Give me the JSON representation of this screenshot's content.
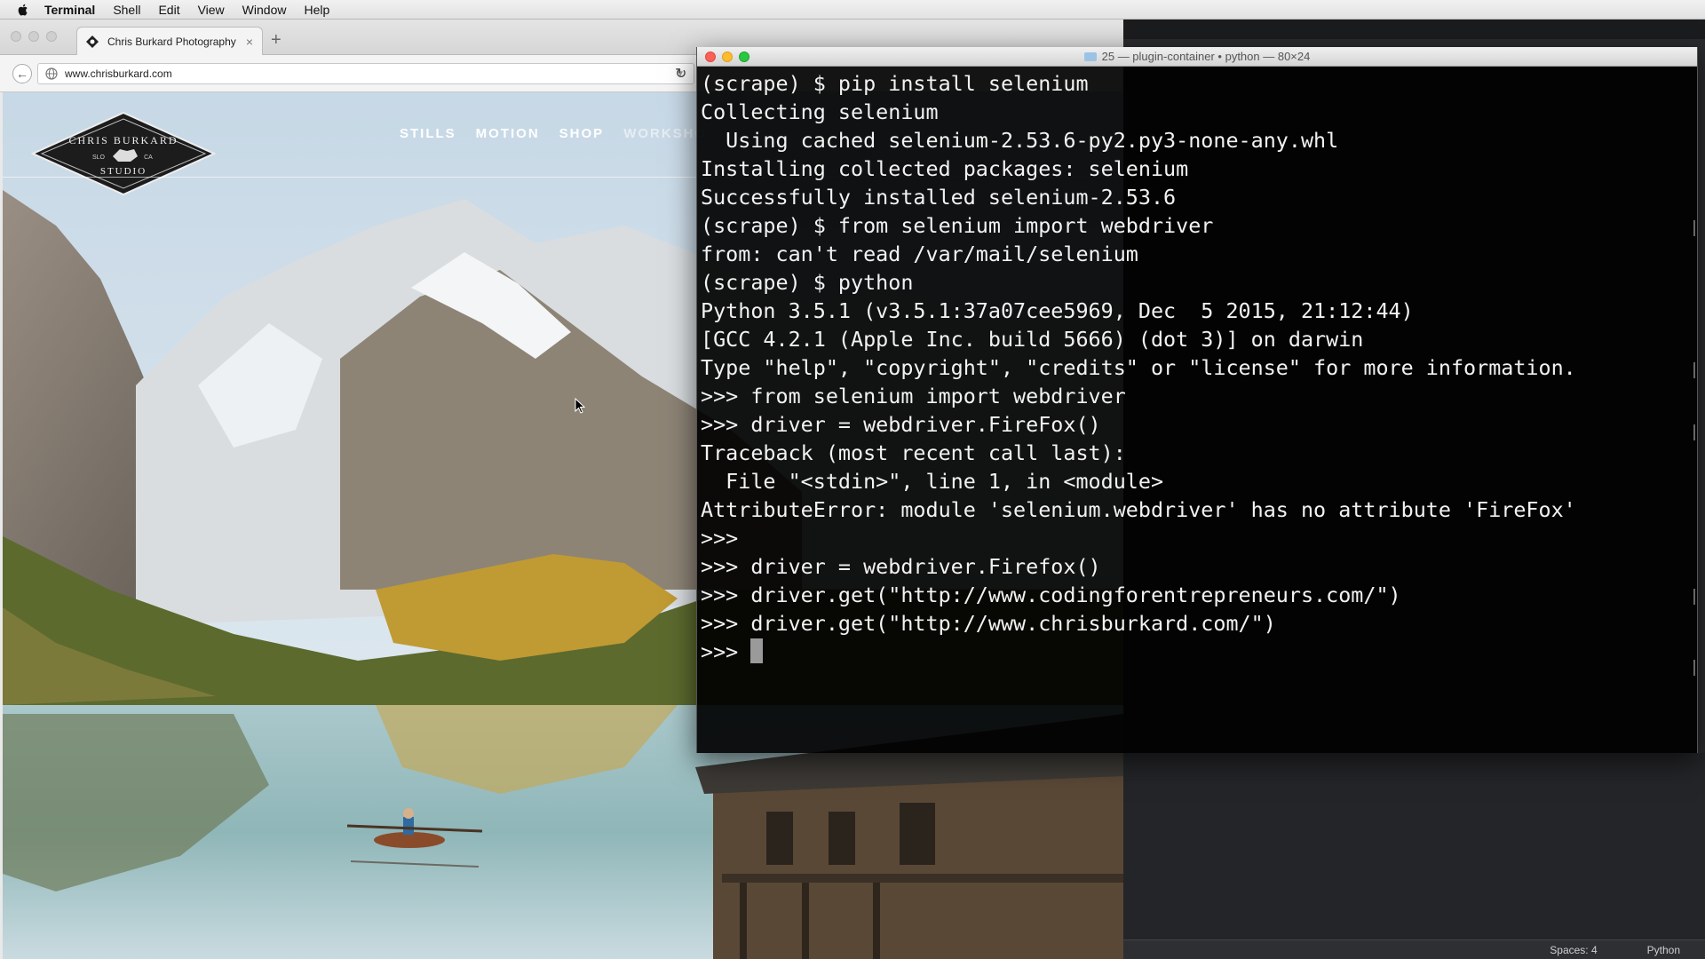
{
  "menubar": {
    "app": "Terminal",
    "items": [
      "Shell",
      "Edit",
      "View",
      "Window",
      "Help"
    ]
  },
  "browser": {
    "tab_title": "Chris Burkard Photography",
    "tab_close": "×",
    "new_tab": "+",
    "url": "www.chrisburkard.com",
    "site": {
      "logo_line1": "CHRIS BURKARD",
      "logo_line2": "STUDIO",
      "logo_left": "SLO",
      "logo_right": "CA",
      "nav": [
        "STILLS",
        "MOTION",
        "SHOP",
        "WORKSHO"
      ]
    }
  },
  "terminal": {
    "title": "25 — plugin-container • python — 80×24",
    "lines": [
      "(scrape) $ pip install selenium",
      "Collecting selenium",
      "  Using cached selenium-2.53.6-py2.py3-none-any.whl",
      "Installing collected packages: selenium",
      "Successfully installed selenium-2.53.6",
      "(scrape) $ from selenium import webdriver",
      "from: can't read /var/mail/selenium",
      "(scrape) $ python",
      "Python 3.5.1 (v3.5.1:37a07cee5969, Dec  5 2015, 21:12:44)",
      "[GCC 4.2.1 (Apple Inc. build 5666) (dot 3)] on darwin",
      "Type \"help\", \"copyright\", \"credits\" or \"license\" for more information.",
      ">>> from selenium import webdriver",
      ">>> driver = webdriver.FireFox()",
      "Traceback (most recent call last):",
      "  File \"<stdin>\", line 1, in <module>",
      "AttributeError: module 'selenium.webdriver' has no attribute 'FireFox'",
      ">>>",
      ">>> driver = webdriver.Firefox()",
      ">>> driver.get(\"http://www.codingforentrepreneurs.com/\")",
      ">>> driver.get(\"http://www.chrisburkard.com/\")"
    ],
    "prompt": ">>> "
  },
  "statusbar": {
    "spaces": "Spaces: 4",
    "language": "Python"
  },
  "colors": {
    "terminal_bg": "#000000",
    "terminal_fg": "#f2f2f2",
    "close": "#fc5f57",
    "minimize": "#fdbb2e",
    "zoom": "#28c840"
  }
}
